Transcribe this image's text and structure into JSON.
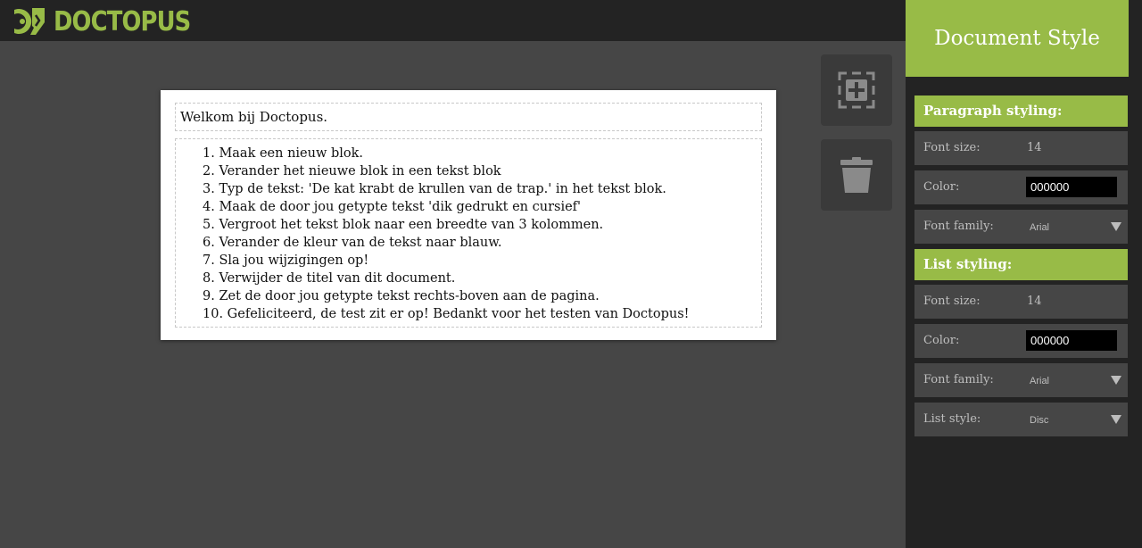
{
  "app": {
    "logo_text": "DOCTOPUS"
  },
  "document": {
    "title": "Welkom bij Doctopus.",
    "list_items": [
      "1. Maak een nieuw blok.",
      "2. Verander het nieuwe blok in een tekst blok",
      "3. Typ de tekst: 'De kat krabt de krullen van de trap.' in het tekst blok.",
      "4. Maak de door jou getypte tekst 'dik gedrukt en cursief'",
      "5. Vergroot het tekst blok naar een breedte van 3 kolommen.",
      "6. Verander de kleur van de tekst naar blauw.",
      "7. Sla jou wijzigingen op!",
      "8. Verwijder de titel van dit document.",
      "9. Zet de door jou getypte tekst rechts-boven aan de pagina.",
      "10. Gefeliciteerd, de test zit er op! Bedankt voor het testen van Doctopus!"
    ]
  },
  "tools": {
    "add_icon": "add-block-icon",
    "delete_icon": "trash-icon"
  },
  "sidebar": {
    "header": "Document Style",
    "paragraph": {
      "title": "Paragraph styling:",
      "font_size_label": "Font size:",
      "font_size_value": "14",
      "color_label": "Color:",
      "color_value": "000000",
      "font_family_label": "Font family:",
      "font_family_value": "Arial"
    },
    "list": {
      "title": "List styling:",
      "font_size_label": "Font size:",
      "font_size_value": "14",
      "color_label": "Color:",
      "color_value": "000000",
      "font_family_label": "Font family:",
      "font_family_value": "Arial",
      "list_style_label": "List style:",
      "list_style_value": "Disc"
    }
  },
  "colors": {
    "accent": "#98bb47",
    "background": "#464646",
    "bar": "#232323"
  }
}
